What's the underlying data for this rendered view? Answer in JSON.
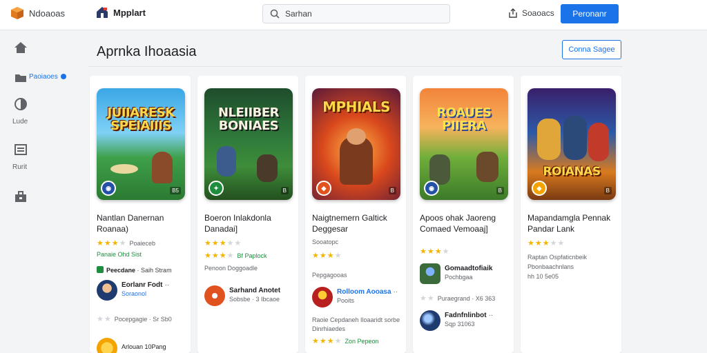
{
  "topbar": {
    "brand1": "Ndoaoas",
    "brand2": "Mpplart",
    "search_value": "Sarhan",
    "link_label": "Soaoacs",
    "button_label": "Peronanr"
  },
  "sidebar": {
    "items": [
      {
        "label": "",
        "icon": "home-icon"
      },
      {
        "label": "Paoiaoes",
        "icon": "folder-icon"
      },
      {
        "label": "Lude",
        "icon": "shield-icon"
      },
      {
        "label": "Rurit",
        "icon": "list-icon"
      },
      {
        "label": "",
        "icon": "briefcase-icon"
      }
    ]
  },
  "panel": {
    "title": "Aprnka Ihoaasia",
    "button_label": "Conna Sagee"
  },
  "cards": [
    {
      "cover_title": "JUIIARESK SPEIAIIIS",
      "cover_age": "B5",
      "title": "Nantlan Danernan Roanaa)",
      "rating_meta": "Poaieceb",
      "line1": "Panaie Ohd Sist",
      "line2_brand": "Peecdane",
      "line2_rest": "· Saih Stram",
      "user1_name": "Eorlanr Fodt",
      "user1_sub": "Soraonol",
      "rating2_meta": "Pocepgagie · Sr Sb0",
      "user2_name": "Arlouan 10Pang"
    },
    {
      "cover_title": "NLEIIBER BONIAES",
      "cover_age": "B",
      "title": "Boeron Inlakdonla Danadai]",
      "rating_meta": "",
      "rating2_meta": "Bf Paplock",
      "line1": "Penoon Doggoadle",
      "user1_name": "Sarhand Anotet",
      "user1_sub": "Sobsbe · 3 Ibcaoe"
    },
    {
      "cover_title": "MPHIALS",
      "cover_age": "B",
      "title": "Naigtnemern Galtick Deggesar",
      "rating_meta": "Sooatopc",
      "line1": "Pepgagooas",
      "user1_name": "Rolloom Aooasa",
      "user1_sub": "Pooits",
      "line2": "Raoie Cepdaneh Iloaaridt sorbe Dinrhiaedes",
      "rating2_meta": "Zon Pepeon"
    },
    {
      "cover_title": "ROAUES PIIERA",
      "cover_age": "B",
      "title": "Apoos ohak Jaoreng Comaed Vemoaaj]",
      "rating_meta": "",
      "user1_name": "Gomaadtofiaik",
      "user1_sub": "Pochbgaa",
      "rating2_meta": "Puraegrand · X6 363",
      "user2_name": "Fadnfnlinbot",
      "user2_sub": "Sqp 31063"
    },
    {
      "cover_title": "ROIANAS",
      "cover_age": "B",
      "title": "Mapandamgla Pennak Pandar Lank",
      "rating_meta": "",
      "line1": "Raptan Ospfaticnbeik",
      "line2": "Pbonbaachnlans",
      "line3": "hh 10 5e05"
    }
  ],
  "colors": {
    "accent": "#1a73e8",
    "star": "#f4b400",
    "green": "#1e8e3e"
  }
}
